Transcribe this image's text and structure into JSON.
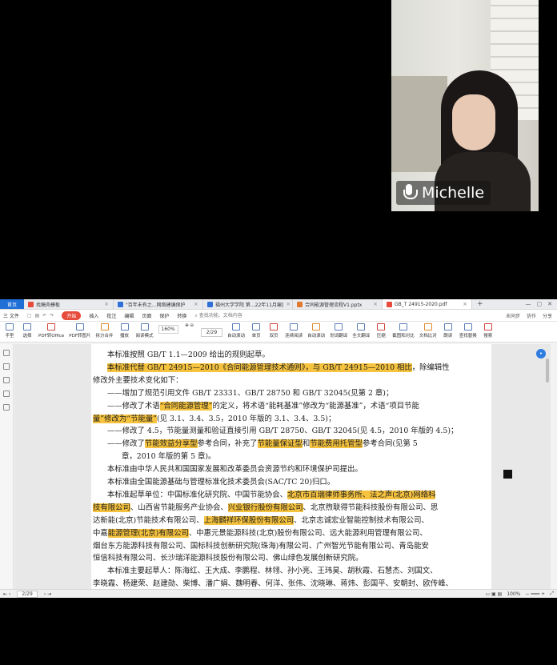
{
  "participant": {
    "name": "Michelle"
  },
  "tabs": [
    {
      "label": "首页",
      "kind": "home"
    },
    {
      "label": "找稿壳模板",
      "color": "#e64b3c"
    },
    {
      "label": "\"百年未有之...网络建编保护",
      "color": "#2f6fd6"
    },
    {
      "label": "福州大学学院 第...22年11月编]",
      "color": "#2f6fd6"
    },
    {
      "label": "合同能源管理流程V1.pptx",
      "color": "#e07a2e"
    },
    {
      "label": "GB_T 24915-2020.pdf",
      "color": "#e64b3c",
      "active": true
    }
  ],
  "menu": {
    "file": "三 文件",
    "start": "开始",
    "items": [
      "插入",
      "批注",
      "编辑",
      "页面",
      "保护",
      "转换"
    ],
    "search": "查找功能、文档内容",
    "right": [
      "未同步",
      "协作",
      "分享"
    ]
  },
  "ribbon": {
    "items": [
      "手型",
      "选择",
      "PDF转Office",
      "PDF转图片",
      "拆分合并",
      "播放",
      "阅读模式"
    ],
    "zoom": "160%",
    "page": "2/29",
    "items2": [
      "自动滚动",
      "单页",
      "双页",
      "连续阅读",
      "自动滚动",
      "划词翻译",
      "全文翻译",
      "压缩",
      "截图和对比",
      "文档比对",
      "朗读",
      "查找替换",
      "搜索"
    ]
  },
  "doc": {
    "lines": [
      [
        {
          "t": "本标准按照 GB/T 1.1—2009 给出的规则起草。"
        }
      ],
      [
        {
          "t": "本标准代替 GB/T 24915—2010《合同能源管理技术通则》，与 GB/T 24915—2010 相比",
          "h": true
        },
        {
          "t": "，除编辑性"
        }
      ],
      [
        {
          "t": "修改外主要技术变化如下："
        }
      ],
      [
        {
          "t": "——增加了规范引用文件 GB/T 23331、GB/T 28750 和 GB/T 32045(见第 2 章)；"
        }
      ],
      [
        {
          "t": "——修改了术语"
        },
        {
          "t": "“合同能源管理”",
          "h": true
        },
        {
          "t": "的定义，将术语“能耗基准”修改为“能源基准”，术语“项目节能"
        }
      ],
      [
        {
          "t": "量”修改为“节能量”",
          "h": true
        },
        {
          "t": "(见 3.1、3.4、3.5，2010 年版的 3.1、3.4、3.5)；"
        }
      ],
      [
        {
          "t": "——修改了 4.5，节能量测量和验证直接引用 GB/T 28750、GB/T 32045(见 4.5，2010 年版的 4.5)；"
        }
      ],
      [
        {
          "t": "——修改了"
        },
        {
          "t": "节能效益分享型",
          "h": true
        },
        {
          "t": "参考合同，补充了"
        },
        {
          "t": "节能量保证型",
          "h": true
        },
        {
          "t": "和"
        },
        {
          "t": "节能费用托管型",
          "h": true
        },
        {
          "t": "参考合同(见第 5"
        }
      ],
      [
        {
          "t": "章，2010 年版的第 5 章)。"
        }
      ],
      [
        {
          "t": "本标准由中华人民共和国国家发展和改革委员会资源节约和环境保护司提出。"
        }
      ],
      [
        {
          "t": "本标准由全国能源基础与管理标准化技术委员会(SAC/TC 20)归口。"
        }
      ],
      [
        {
          "t": "本标准起草单位：中国标准化研究院、中国节能协会、"
        },
        {
          "t": "北京市百瑞律师事务所、法之声(北京)网络科",
          "h": true
        }
      ],
      [
        {
          "t": "技有限公司",
          "h": true
        },
        {
          "t": "、山西省节能服务产业协会、"
        },
        {
          "t": "兴业银行股份有限公司",
          "h": true
        },
        {
          "t": "、北京煦联得节能科技股份有限公司、思"
        }
      ],
      [
        {
          "t": "达新能(北京)节能技术有限公司、"
        },
        {
          "t": "上海麟祥环保股份有限公司",
          "h": true
        },
        {
          "t": "、北京志诚宏业智能控制技术有限公司、"
        }
      ],
      [
        {
          "t": "中嘉"
        },
        {
          "t": "能源管理(北京)有限公司",
          "h": true
        },
        {
          "t": "、中惠元景能源科技(北京)股份有限公司、远大能源利用管理有限公司、"
        }
      ],
      [
        {
          "t": "烟台东方能源科技有限公司、国标科技创新研究院(珠海)有限公司、广州智光节能有限公司、青岛能安"
        }
      ],
      [
        {
          "t": "恒信科技有限公司、长沙瑞洋能源科技股份有限公司、佛山绿色发展创新研究院。"
        }
      ],
      [
        {
          "t": "本标准主要起草人：陈海红、王大成、李鹏程、林翎、孙小亮、王玮昊、胡秋霞、石慧杰、刘国文、"
        }
      ],
      [
        {
          "t": "李晓霞、杨建荣、赵建勋、柴博、潘广娟、魏明春、何洋、张伟、沈晓琳、蒋炜、彭国平、安朝封、欧传峰、"
        }
      ]
    ]
  },
  "status": {
    "page": "2/29",
    "zoom": "100%"
  },
  "colors": {
    "highlight": "#f6c33f",
    "accent": "#1f6fd6",
    "start": "#e64b3c"
  }
}
